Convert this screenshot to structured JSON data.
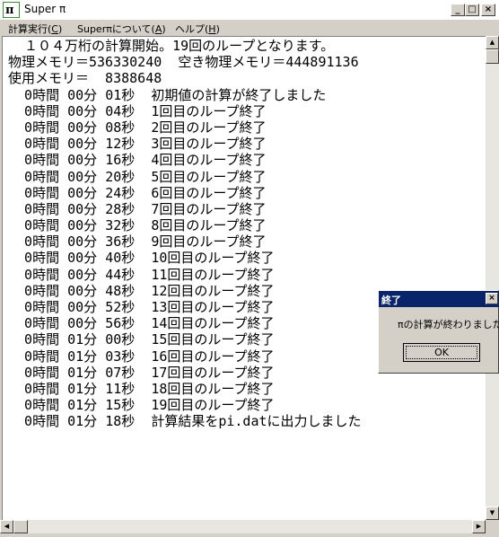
{
  "window": {
    "title": "Super π",
    "controls": {
      "minimize": "_",
      "maximize": "□",
      "close": "×"
    }
  },
  "menu": [
    {
      "label": "計算実行(",
      "key": "C",
      "suffix": ")"
    },
    {
      "label": "Superπについて(",
      "key": "A",
      "suffix": ")"
    },
    {
      "label": "ヘルプ(",
      "key": "H",
      "suffix": ")"
    }
  ],
  "log": {
    "lines": [
      "  １０４万桁の計算開始。19回のループとなります。",
      "物理メモリ＝536330240  空き物理メモリ＝444891136",
      "使用メモリ＝  8388648",
      "  0時間 00分 01秒  初期値の計算が終了しました",
      "  0時間 00分 04秒  1回目のループ終了",
      "  0時間 00分 08秒  2回目のループ終了",
      "  0時間 00分 12秒  3回目のループ終了",
      "  0時間 00分 16秒  4回目のループ終了",
      "  0時間 00分 20秒  5回目のループ終了",
      "  0時間 00分 24秒  6回目のループ終了",
      "  0時間 00分 28秒  7回目のループ終了",
      "  0時間 00分 32秒  8回目のループ終了",
      "  0時間 00分 36秒  9回目のループ終了",
      "  0時間 00分 40秒  10回目のループ終了",
      "  0時間 00分 44秒  11回目のループ終了",
      "  0時間 00分 48秒  12回目のループ終了",
      "  0時間 00分 52秒  13回目のループ終了",
      "  0時間 00分 56秒  14回目のループ終了",
      "  0時間 01分 00秒  15回目のループ終了",
      "  0時間 01分 03秒  16回目のループ終了",
      "  0時間 01分 07秒  17回目のループ終了",
      "  0時間 01分 11秒  18回目のループ終了",
      "  0時間 01分 15秒  19回目のループ終了",
      "  0時間 01分 18秒  計算結果をpi.datに出力しました"
    ]
  },
  "dialog": {
    "title": "終了",
    "message": "πの計算が終わりました",
    "ok_label": "OK",
    "close": "×"
  },
  "scrollbar_glyphs": {
    "up": "▲",
    "down": "▼",
    "left": "◀",
    "right": "▶"
  },
  "colors": {
    "dialog_titlebar": "#0a246a",
    "face": "#d4d0c8",
    "client": "#ffffff"
  }
}
